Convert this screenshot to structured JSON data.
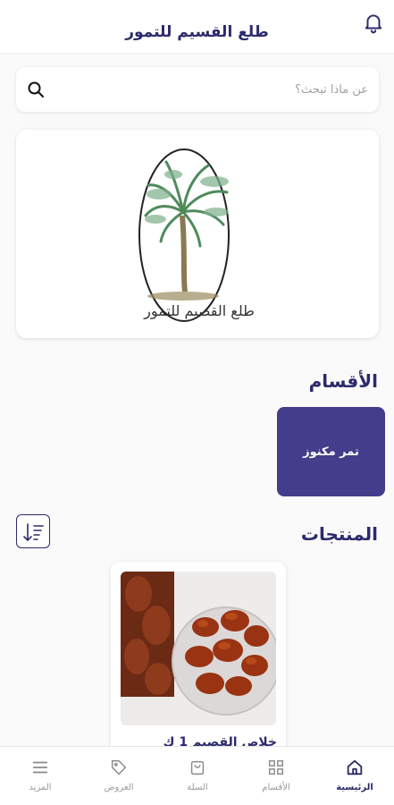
{
  "header": {
    "title": "طلع القسيم للتمور"
  },
  "search": {
    "placeholder": "عن ماذا تبحث؟"
  },
  "banner": {
    "logo_text": "طلع القصيم للتمور"
  },
  "categories": {
    "title": "الأقسام",
    "items": [
      {
        "label": "تمر مكنوز"
      }
    ]
  },
  "products": {
    "title": "المنتجات",
    "items": [
      {
        "name": "خلاص القصيم 1 ك"
      }
    ]
  },
  "bottom_nav": {
    "items": [
      {
        "label": "الرئيسية",
        "icon": "home-icon",
        "active": true
      },
      {
        "label": "الأقسام",
        "icon": "grid-icon",
        "active": false
      },
      {
        "label": "السلة",
        "icon": "bag-icon",
        "active": false
      },
      {
        "label": "العروض",
        "icon": "tag-icon",
        "active": false
      },
      {
        "label": "المزيد",
        "icon": "menu-icon",
        "active": false
      }
    ]
  },
  "colors": {
    "primary": "#2c2a6b",
    "category_card": "#433d8b",
    "background": "#fafafa"
  }
}
